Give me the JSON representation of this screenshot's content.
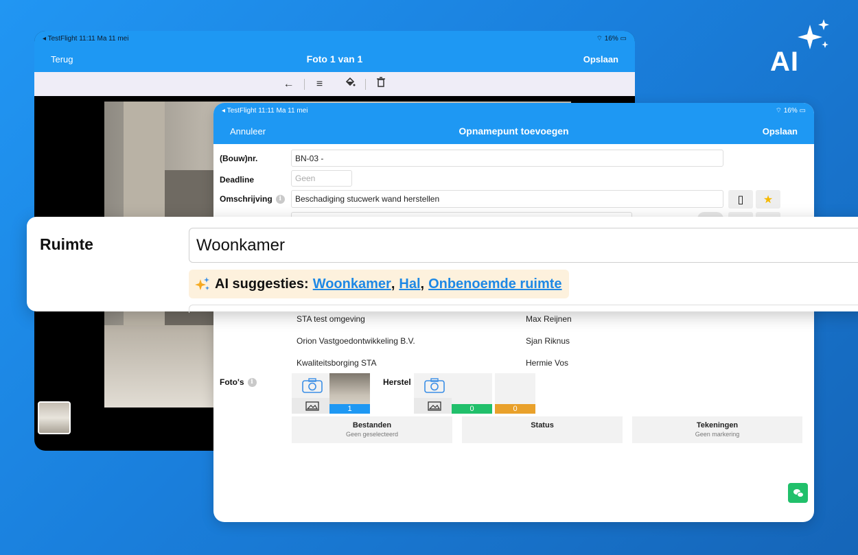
{
  "ai_badge": {
    "text": "AI"
  },
  "back_app": {
    "status": {
      "left": "◂ TestFlight  11:11  Ma 11 mei",
      "right": "16%"
    },
    "nav": {
      "back": "Terug",
      "title": "Foto 1 van 1",
      "save": "Opslaan"
    },
    "toolbar": {
      "back_icon": "←",
      "menu_icon": "≡",
      "paint_icon": "paint-bucket-icon",
      "delete_icon": "trash-icon"
    }
  },
  "front_app": {
    "status": {
      "left": "◂ TestFlight  11:11  Ma 11 mei",
      "right": "16%"
    },
    "nav": {
      "cancel": "Annuleer",
      "title": "Opnamepunt toevoegen",
      "save": "Opslaan"
    },
    "form": {
      "bouwnr_label": "(Bouw)nr.",
      "bouwnr_value": "BN-03 -",
      "deadline_label": "Deadline",
      "deadline_placeholder": "Geen",
      "omschrijving_label": "Omschrijving",
      "omschrijving_value": "Beschadiging stucwerk wand herstellen"
    },
    "parties": [
      {
        "name": "STA test omgeving",
        "person": "Max Reijnen"
      },
      {
        "name": "Orion Vastgoedontwikkeling B.V.",
        "person": "Sjan Riknus"
      },
      {
        "name": "Kwaliteitsborging STA",
        "person": "Hermie Vos"
      }
    ],
    "photos_label": "Foto's",
    "photo_count": "1",
    "herstel_label": "Herstel",
    "herstel_green_count": "0",
    "herstel_orange_count": "0",
    "cards": [
      {
        "title": "Bestanden",
        "subtitle": "Geen geselecteerd"
      },
      {
        "title": "Status",
        "subtitle": ""
      },
      {
        "title": "Tekeningen",
        "subtitle": "Geen markering"
      }
    ],
    "colors": {
      "accent": "#1e98f3",
      "green": "#21c06b",
      "orange": "#e9a12b",
      "star": "#f5b800"
    }
  },
  "callout": {
    "label": "Ruimte",
    "value": "Woonkamer",
    "suggestions_prefix": "AI suggesties:",
    "suggestions": [
      "Woonkamer",
      "Hal",
      "Onbenoemde ruimte"
    ]
  }
}
